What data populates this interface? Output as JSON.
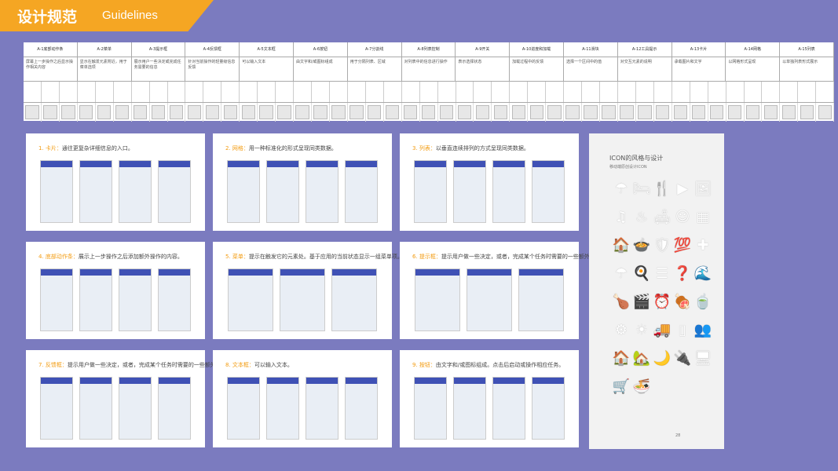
{
  "banner": {
    "title_cn": "设计规范",
    "title_en": "Guidelines"
  },
  "spec": {
    "headers": [
      "A-1底部动作条",
      "A-2菜单",
      "A-3提示框",
      "A-4反馈框",
      "A-5文本框",
      "A-6按钮",
      "A-7分割线",
      "A-8列表控制",
      "A-9开关",
      "A-10进度和加载",
      "A-11滑块",
      "A-12工具提示",
      "A-13卡片",
      "A-14网格",
      "A-15列表"
    ],
    "descs": [
      "屏幕上一步操作之后显示操作相关内容",
      "显示在触发元素附近，用于菜单选项",
      "展示用户一些决定或完成任务需要的信息",
      "针对当前操作的轻量级信息反馈",
      "可以输入文本",
      "由文字和/或图标组成",
      "用于分隔列表、区域",
      "对列表中的信息进行操作",
      "表示选择状态",
      "加载过程中的反馈",
      "选择一个区间中的值",
      "对交互元素的说明",
      "承载图片和文字",
      "以网格形式呈现",
      "以单独列表形式展示"
    ]
  },
  "cards": [
    {
      "num": "1. 卡片：",
      "text": "通往更复杂详细信息的入口。"
    },
    {
      "num": "2. 网格：",
      "text": "用一种标准化的形式呈现同类数据。"
    },
    {
      "num": "3. 列表：",
      "text": "以垂直连续排列的方式呈现同类数据。"
    },
    {
      "num": "4. 底部动作条：",
      "text": "展示上一步操作之后添加额外操作的内容。"
    },
    {
      "num": "5. 菜单：",
      "text": "提示在触发它的元素处。基于应用的当前状态显示一组菜单项。"
    },
    {
      "num": "6. 提示框：",
      "text": "提示用户做一些决定，或者，完成某个任务时需要的一些额外的信息。"
    },
    {
      "num": "7. 反馈框：",
      "text": "提示用户做一些决定，或者，完成某个任务时需要的一些额外的信息。"
    },
    {
      "num": "8. 文本框：",
      "text": "可以输入文本。"
    },
    {
      "num": "9. 按钮：",
      "text": "由文字和/或图标组成。点击后启动或操作相应任务。"
    }
  ],
  "icons_panel": {
    "title": "ICON的风格与设计",
    "subtitle": "移动端原创设计ICON",
    "page": "28",
    "icons": [
      "☂",
      "🛏",
      "🍴",
      "▶",
      "🖼",
      "♫",
      "♨",
      "🛋",
      "☺",
      "▦",
      "🏠",
      "🍲",
      "🛡",
      "💯",
      "✚",
      "☂",
      "🍳",
      "☰",
      "❓",
      "🌊",
      "🍗",
      "🎬",
      "⏰",
      "🍖",
      "🍵",
      "⚙",
      "☀",
      "🚚",
      "▯",
      "👥",
      "🏠",
      "🏡",
      "🌙",
      "🔌",
      "🖥",
      "🛒",
      "🍜"
    ]
  }
}
